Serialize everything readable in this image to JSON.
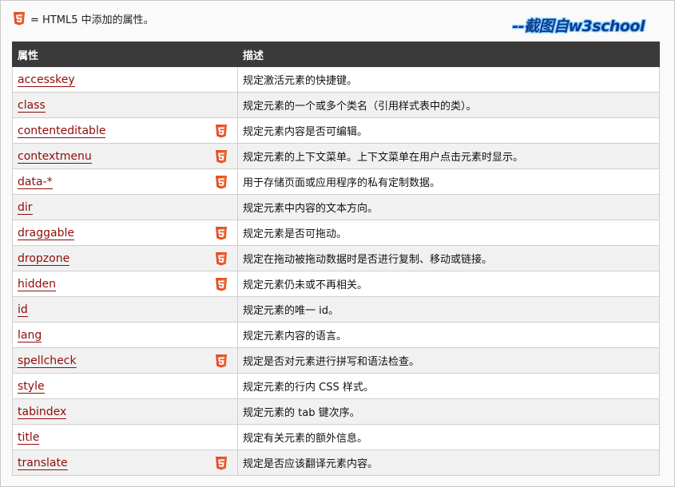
{
  "legend": {
    "text": "= HTML5 中添加的属性。"
  },
  "watermark": "--截图自w3school",
  "table": {
    "header_attr": "属性",
    "header_desc": "描述",
    "rows": [
      {
        "attr": "accesskey",
        "desc": "规定激活元素的快捷键。",
        "html5": false
      },
      {
        "attr": "class",
        "desc": "规定元素的一个或多个类名（引用样式表中的类）。",
        "html5": false
      },
      {
        "attr": "contenteditable",
        "desc": "规定元素内容是否可编辑。",
        "html5": true
      },
      {
        "attr": "contextmenu",
        "desc": "规定元素的上下文菜单。上下文菜单在用户点击元素时显示。",
        "html5": true
      },
      {
        "attr": "data-*",
        "desc": "用于存储页面或应用程序的私有定制数据。",
        "html5": true
      },
      {
        "attr": "dir",
        "desc": "规定元素中内容的文本方向。",
        "html5": false
      },
      {
        "attr": "draggable",
        "desc": "规定元素是否可拖动。",
        "html5": true
      },
      {
        "attr": "dropzone",
        "desc": "规定在拖动被拖动数据时是否进行复制、移动或链接。",
        "html5": true
      },
      {
        "attr": "hidden",
        "desc": "规定元素仍未或不再相关。",
        "html5": true
      },
      {
        "attr": "id",
        "desc": "规定元素的唯一 id。",
        "html5": false
      },
      {
        "attr": "lang",
        "desc": "规定元素内容的语言。",
        "html5": false
      },
      {
        "attr": "spellcheck",
        "desc": "规定是否对元素进行拼写和语法检查。",
        "html5": true
      },
      {
        "attr": "style",
        "desc": "规定元素的行内 CSS 样式。",
        "html5": false
      },
      {
        "attr": "tabindex",
        "desc": "规定元素的 tab 键次序。",
        "html5": false
      },
      {
        "attr": "title",
        "desc": "规定有关元素的额外信息。",
        "html5": false
      },
      {
        "attr": "translate",
        "desc": "规定是否应该翻译元素内容。",
        "html5": true
      }
    ]
  },
  "colors": {
    "header_bg": "#3a3a3a",
    "link": "#900b09",
    "html5_badge": "#e34f26"
  },
  "icons": {
    "html5": "html5-badge-icon"
  }
}
